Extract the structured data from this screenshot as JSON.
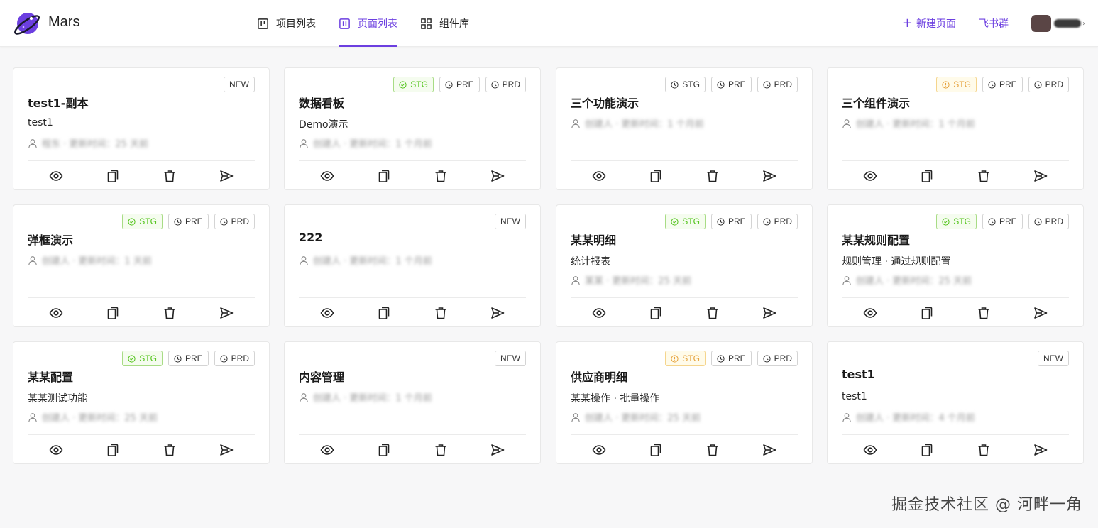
{
  "header": {
    "brand": "Mars",
    "nav": [
      {
        "label": "项目列表",
        "icon": "project-list-icon",
        "active": false
      },
      {
        "label": "页面列表",
        "icon": "page-list-icon",
        "active": true
      },
      {
        "label": "组件库",
        "icon": "component-grid-icon",
        "active": false
      }
    ],
    "new_page_label": "新建页面",
    "feishu_label": "飞书群"
  },
  "colors": {
    "accent": "#6c3fe0",
    "stg_ok": "#52c41a",
    "stg_warn": "#e6a23c"
  },
  "cards": [
    {
      "title": "test1-副本",
      "desc": "test1",
      "meta": "程东 · 更新时间：25 天前",
      "tags": [
        {
          "label": "NEW",
          "kind": "plain",
          "icon": "none"
        }
      ]
    },
    {
      "title": "数据看板",
      "desc": "Demo演示",
      "meta": "创建人 · 更新时间：1 个月前",
      "tags": [
        {
          "label": "STG",
          "kind": "ok",
          "icon": "check-circle-icon"
        },
        {
          "label": "PRE",
          "kind": "plain",
          "icon": "clock-icon"
        },
        {
          "label": "PRD",
          "kind": "plain",
          "icon": "clock-icon"
        }
      ]
    },
    {
      "title": "三个功能演示",
      "desc": "",
      "meta": "创建人 · 更新时间：1 个月前",
      "tags": [
        {
          "label": "STG",
          "kind": "plain",
          "icon": "clock-icon"
        },
        {
          "label": "PRE",
          "kind": "plain",
          "icon": "clock-icon"
        },
        {
          "label": "PRD",
          "kind": "plain",
          "icon": "clock-icon"
        }
      ]
    },
    {
      "title": "三个组件演示",
      "desc": "",
      "meta": "创建人 · 更新时间：1 个月前",
      "tags": [
        {
          "label": "STG",
          "kind": "warn",
          "icon": "warning-circle-icon"
        },
        {
          "label": "PRE",
          "kind": "plain",
          "icon": "clock-icon"
        },
        {
          "label": "PRD",
          "kind": "plain",
          "icon": "clock-icon"
        }
      ]
    },
    {
      "title": "弹框演示",
      "desc": "",
      "meta": "创建人 · 更新时间：1 天前",
      "tags": [
        {
          "label": "STG",
          "kind": "ok",
          "icon": "check-circle-icon"
        },
        {
          "label": "PRE",
          "kind": "plain",
          "icon": "clock-icon"
        },
        {
          "label": "PRD",
          "kind": "plain",
          "icon": "clock-icon"
        }
      ]
    },
    {
      "title": "222",
      "desc": "",
      "meta": "创建人 · 更新时间：1 个月前",
      "tags": [
        {
          "label": "NEW",
          "kind": "plain",
          "icon": "none"
        }
      ]
    },
    {
      "title": "某某明细",
      "desc": "统计报表",
      "meta": "某某 · 更新时间：25 天前",
      "tags": [
        {
          "label": "STG",
          "kind": "ok",
          "icon": "check-circle-icon"
        },
        {
          "label": "PRE",
          "kind": "plain",
          "icon": "clock-icon"
        },
        {
          "label": "PRD",
          "kind": "plain",
          "icon": "clock-icon"
        }
      ]
    },
    {
      "title": "某某规则配置",
      "desc": "规则管理 · 通过规则配置",
      "meta": "创建人 · 更新时间：25 天前",
      "tags": [
        {
          "label": "STG",
          "kind": "ok",
          "icon": "check-circle-icon"
        },
        {
          "label": "PRE",
          "kind": "plain",
          "icon": "clock-icon"
        },
        {
          "label": "PRD",
          "kind": "plain",
          "icon": "clock-icon"
        }
      ]
    },
    {
      "title": "某某配置",
      "desc": "某某测试功能",
      "meta": "创建人 · 更新时间：25 天前",
      "tags": [
        {
          "label": "STG",
          "kind": "ok",
          "icon": "check-circle-icon"
        },
        {
          "label": "PRE",
          "kind": "plain",
          "icon": "clock-icon"
        },
        {
          "label": "PRD",
          "kind": "plain",
          "icon": "clock-icon"
        }
      ]
    },
    {
      "title": "内容管理",
      "desc": "",
      "meta": "创建人 · 更新时间：1 个月前",
      "tags": [
        {
          "label": "NEW",
          "kind": "plain",
          "icon": "none"
        }
      ]
    },
    {
      "title": "供应商明细",
      "desc": "某某操作 · 批量操作",
      "meta": "创建人 · 更新时间：25 天前",
      "tags": [
        {
          "label": "STG",
          "kind": "warn",
          "icon": "warning-circle-icon"
        },
        {
          "label": "PRE",
          "kind": "plain",
          "icon": "clock-icon"
        },
        {
          "label": "PRD",
          "kind": "plain",
          "icon": "clock-icon"
        }
      ]
    },
    {
      "title": "test1",
      "desc": "test1",
      "meta": "创建人 · 更新时间：4 个月前",
      "tags": [
        {
          "label": "NEW",
          "kind": "plain",
          "icon": "none"
        }
      ]
    }
  ],
  "watermark": "掘金技术社区 @ 河畔一角"
}
